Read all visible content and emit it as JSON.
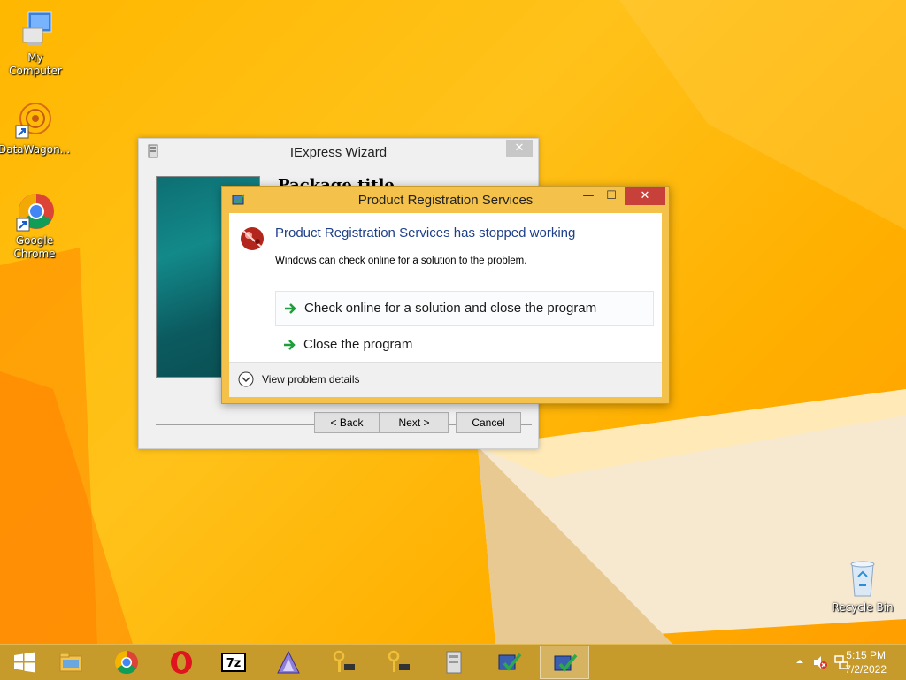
{
  "desktop": {
    "icons": [
      {
        "label": "My Computer",
        "icon": "computer-icon"
      },
      {
        "label": "DataWagon...",
        "icon": "datawagon-icon"
      },
      {
        "label": "Google Chrome",
        "icon": "chrome-icon"
      },
      {
        "label": "Recycle Bin",
        "icon": "recycle-bin-icon"
      }
    ],
    "colors": {
      "wallpaper": "#ffb700",
      "taskbar": "#c79a2c"
    }
  },
  "iexpress": {
    "title": "IExpress Wizard",
    "heading": "Package title",
    "buttons": {
      "back": "< Back",
      "next": "Next >",
      "cancel": "Cancel"
    }
  },
  "dialog": {
    "title": "Product Registration Services",
    "error_title": "Product Registration Services has stopped working",
    "error_desc": "Windows can check online for a solution to the problem.",
    "options": [
      {
        "label": "Check online for a solution and close the program"
      },
      {
        "label": "Close the program"
      }
    ],
    "details_label": "View problem details",
    "controls": {
      "minimize": "—",
      "maximize": "☐",
      "close": "✕"
    }
  },
  "taskbar": {
    "items": [
      "windows-start",
      "file-explorer",
      "chrome",
      "opera",
      "7zip",
      "app-a",
      "keys-1",
      "keys-2",
      "archive",
      "checklist-1",
      "checklist-2"
    ],
    "clock_time": "5:15 PM",
    "clock_date": "7/2/2022"
  }
}
